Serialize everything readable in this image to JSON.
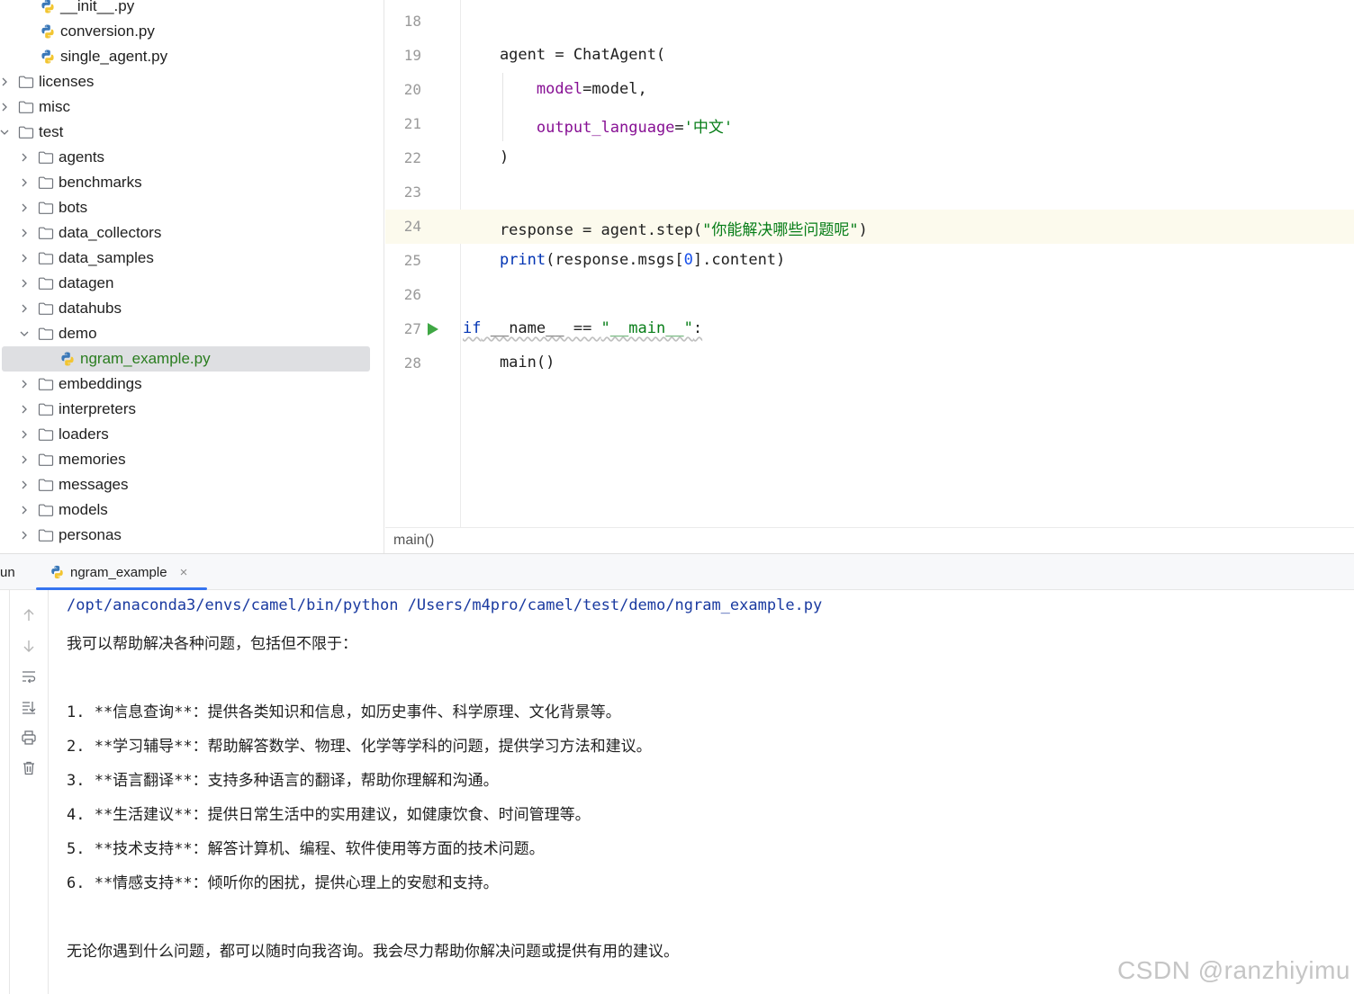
{
  "project_tree": {
    "items": [
      {
        "label": "__init__.py",
        "type": "python",
        "depth": 2,
        "expanded": null
      },
      {
        "label": "conversion.py",
        "type": "python",
        "depth": 2,
        "expanded": null
      },
      {
        "label": "single_agent.py",
        "type": "python",
        "depth": 2,
        "expanded": null
      },
      {
        "label": "licenses",
        "type": "folder",
        "depth": 0,
        "expanded": false
      },
      {
        "label": "misc",
        "type": "folder",
        "depth": 0,
        "expanded": false
      },
      {
        "label": "test",
        "type": "folder",
        "depth": 0,
        "expanded": true
      },
      {
        "label": "agents",
        "type": "folder",
        "depth": 1,
        "expanded": false
      },
      {
        "label": "benchmarks",
        "type": "folder",
        "depth": 1,
        "expanded": false
      },
      {
        "label": "bots",
        "type": "folder",
        "depth": 1,
        "expanded": false
      },
      {
        "label": "data_collectors",
        "type": "folder",
        "depth": 1,
        "expanded": false
      },
      {
        "label": "data_samples",
        "type": "folder",
        "depth": 1,
        "expanded": false
      },
      {
        "label": "datagen",
        "type": "folder",
        "depth": 1,
        "expanded": false
      },
      {
        "label": "datahubs",
        "type": "folder",
        "depth": 1,
        "expanded": false
      },
      {
        "label": "demo",
        "type": "folder",
        "depth": 1,
        "expanded": true
      },
      {
        "label": "ngram_example.py",
        "type": "python",
        "depth": 2,
        "expanded": null,
        "selected": true
      },
      {
        "label": "embeddings",
        "type": "folder",
        "depth": 1,
        "expanded": false
      },
      {
        "label": "interpreters",
        "type": "folder",
        "depth": 1,
        "expanded": false
      },
      {
        "label": "loaders",
        "type": "folder",
        "depth": 1,
        "expanded": false
      },
      {
        "label": "memories",
        "type": "folder",
        "depth": 1,
        "expanded": false
      },
      {
        "label": "messages",
        "type": "folder",
        "depth": 1,
        "expanded": false
      },
      {
        "label": "models",
        "type": "folder",
        "depth": 1,
        "expanded": false
      },
      {
        "label": "personas",
        "type": "folder",
        "depth": 1,
        "expanded": false
      }
    ]
  },
  "editor": {
    "lines": [
      {
        "number": "18",
        "segments": []
      },
      {
        "number": "19",
        "segments": [
          {
            "t": "    agent = ChatAgent(",
            "c": ""
          }
        ]
      },
      {
        "number": "20",
        "segments": [
          {
            "t": "        ",
            "c": ""
          },
          {
            "t": "model",
            "c": "param"
          },
          {
            "t": "=model,",
            "c": ""
          }
        ]
      },
      {
        "number": "21",
        "segments": [
          {
            "t": "        ",
            "c": ""
          },
          {
            "t": "output_language",
            "c": "param"
          },
          {
            "t": "=",
            "c": ""
          },
          {
            "t": "'中文'",
            "c": "str"
          }
        ]
      },
      {
        "number": "22",
        "segments": [
          {
            "t": "    )",
            "c": ""
          }
        ]
      },
      {
        "number": "23",
        "segments": []
      },
      {
        "number": "24",
        "current": true,
        "segments": [
          {
            "t": "    response = agent.step(",
            "c": ""
          },
          {
            "t": "\"你能解决哪些问题呢\"",
            "c": "str"
          },
          {
            "t": ")",
            "c": ""
          }
        ]
      },
      {
        "number": "25",
        "segments": [
          {
            "t": "    ",
            "c": ""
          },
          {
            "t": "print",
            "c": "builtin"
          },
          {
            "t": "(response.msgs[",
            "c": ""
          },
          {
            "t": "0",
            "c": "num"
          },
          {
            "t": "].content)",
            "c": ""
          }
        ]
      },
      {
        "number": "26",
        "segments": []
      },
      {
        "number": "27",
        "run_marker": true,
        "segments": [
          {
            "t": "if",
            "c": "kw wavy"
          },
          {
            "t": " __name__ == ",
            "c": "wavy"
          },
          {
            "t": "\"__main__\"",
            "c": "str wavy"
          },
          {
            "t": ":",
            "c": "wavy"
          }
        ]
      },
      {
        "number": "28",
        "segments": [
          {
            "t": "    main()",
            "c": ""
          }
        ]
      }
    ],
    "breadcrumb": "main()"
  },
  "run_panel": {
    "title": "un",
    "tab_label": "ngram_example",
    "tab_close": "×",
    "output": [
      {
        "text": "/opt/anaconda3/envs/camel/bin/python /Users/m4pro/camel/test/demo/ngram_example.py",
        "kind": "cmd"
      },
      {
        "text": "我可以帮助解决各种问题，包括但不限于：",
        "kind": "zh"
      },
      {
        "text": "",
        "kind": "zh"
      },
      {
        "text": "1. **信息查询**：提供各类知识和信息，如历史事件、科学原理、文化背景等。",
        "kind": "mixed"
      },
      {
        "text": "2. **学习辅导**：帮助解答数学、物理、化学等学科的问题，提供学习方法和建议。",
        "kind": "mixed"
      },
      {
        "text": "3. **语言翻译**：支持多种语言的翻译，帮助你理解和沟通。",
        "kind": "mixed"
      },
      {
        "text": "4. **生活建议**：提供日常生活中的实用建议，如健康饮食、时间管理等。",
        "kind": "mixed"
      },
      {
        "text": "5. **技术支持**：解答计算机、编程、软件使用等方面的技术问题。",
        "kind": "mixed"
      },
      {
        "text": "6. **情感支持**：倾听你的困扰，提供心理上的安慰和支持。",
        "kind": "mixed"
      },
      {
        "text": "",
        "kind": "zh"
      },
      {
        "text": "无论你遇到什么问题，都可以随时向我咨询。我会尽力帮助你解决问题或提供有用的建议。",
        "kind": "zh"
      }
    ]
  },
  "sidebar_buttons": [
    "arrow-up-icon",
    "arrow-down-icon",
    "soft-wrap-icon",
    "scroll-to-end-icon",
    "print-icon",
    "trash-icon"
  ],
  "watermark": "CSDN @ranzhiyimu",
  "colors": {
    "keyword": "#0033b3",
    "string": "#067d17",
    "parameter": "#871094",
    "number": "#1750eb",
    "command": "#1a3aa0",
    "selection": "#dedfe2",
    "tab_underline": "#3574f0"
  }
}
